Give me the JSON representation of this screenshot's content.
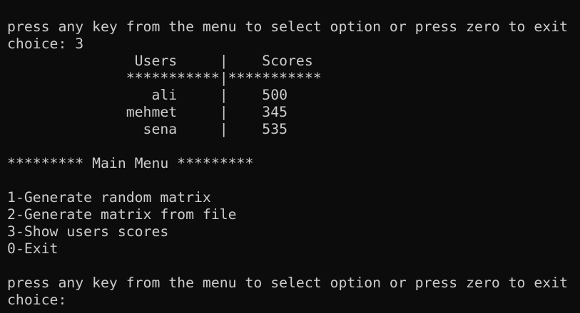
{
  "terminal": {
    "lines": [
      "press any key from the menu to select option or press zero to exit",
      "choice: 3",
      "               Users     |    Scores",
      "              ***********|***********",
      "                 ali     |    500",
      "              mehmet     |    345",
      "                sena     |    535",
      "",
      "********* Main Menu *********",
      "",
      "1-Generate random matrix",
      "2-Generate matrix from file",
      "3-Show users scores",
      "0-Exit",
      "",
      "press any key from the menu to select option or press zero to exit",
      "choice: "
    ]
  }
}
